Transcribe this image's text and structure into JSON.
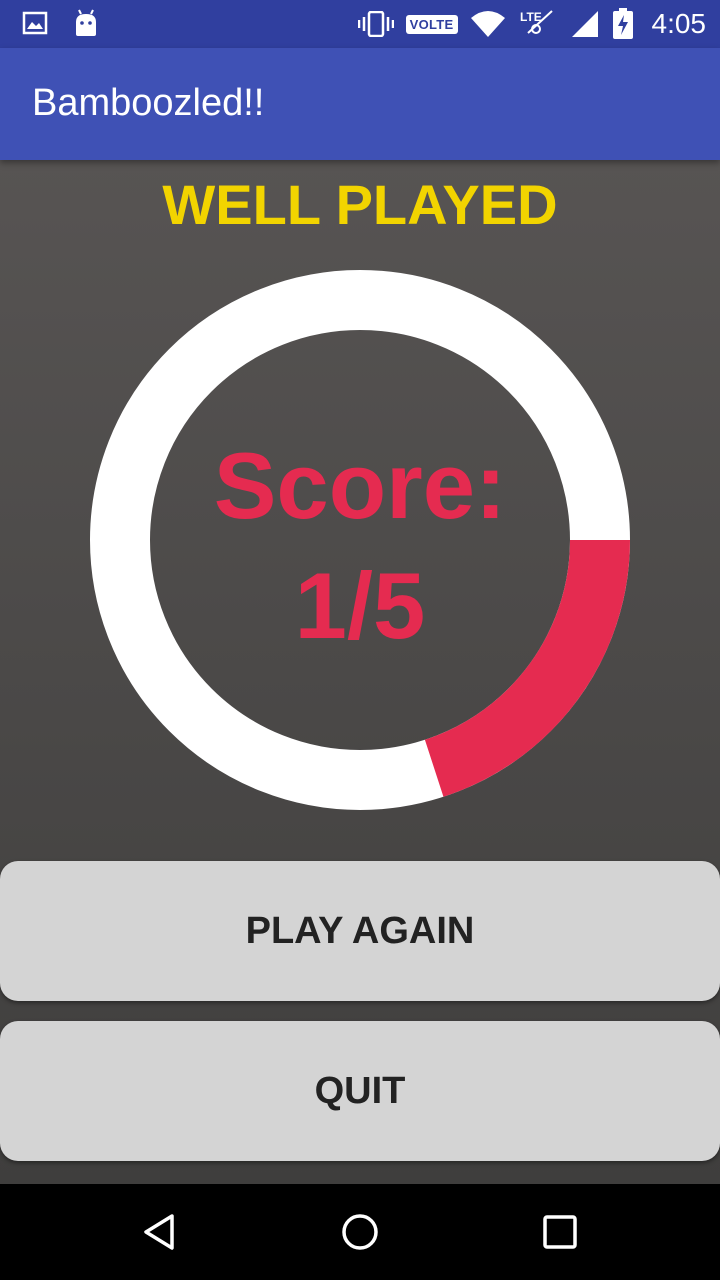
{
  "status_bar": {
    "time": "4:05",
    "volte": "VOLTE",
    "icons": [
      "gallery-icon",
      "android-icon",
      "vibrate-icon",
      "wifi-icon",
      "lte-icon",
      "signal-icon",
      "battery-charging-icon"
    ]
  },
  "app_bar": {
    "title": "Bamboozled!!",
    "color": "#3f51b5"
  },
  "result": {
    "title": "WELL PLAYED",
    "score_label": "Score:",
    "score_value": "1/5",
    "score": 1,
    "total": 5,
    "title_color": "#f2d400",
    "score_color": "#e52b50"
  },
  "buttons": {
    "play_again": "PLAY AGAIN",
    "quit": "QUIT"
  },
  "nav_bar": {
    "icons": [
      "back-icon",
      "home-icon",
      "recent-apps-icon"
    ]
  }
}
